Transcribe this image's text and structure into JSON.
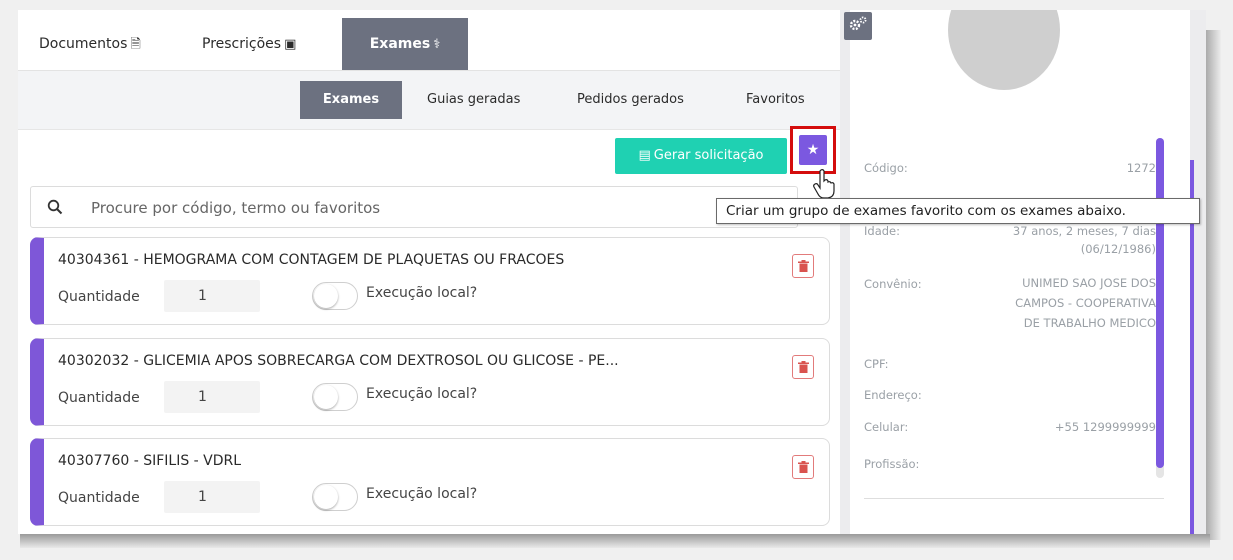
{
  "tabs": {
    "documents": "Documentos",
    "prescriptions": "Prescrições",
    "exams": "Exames"
  },
  "subtabs": {
    "exams": "Exames",
    "guides": "Guias geradas",
    "orders": "Pedidos gerados",
    "favorites": "Favoritos"
  },
  "actions": {
    "generate_request": "Gerar solicitação"
  },
  "search": {
    "placeholder": "Procure por código, termo ou favoritos"
  },
  "tooltip": "Criar um grupo de exames favorito com os exames abaixo.",
  "exam_items": [
    {
      "title": "40304361 - HEMOGRAMA COM CONTAGEM DE PLAQUETAS OU FRACOES",
      "qty_label": "Quantidade",
      "qty": "1",
      "exec_label": "Execução local?"
    },
    {
      "title": "40302032 - GLICEMIA APOS SOBRECARGA COM DEXTROSOL OU GLICOSE - PE...",
      "qty_label": "Quantidade",
      "qty": "1",
      "exec_label": "Execução local?"
    },
    {
      "title": "40307760 - SIFILIS - VDRL",
      "qty_label": "Quantidade",
      "qty": "1",
      "exec_label": "Execução local?"
    }
  ],
  "patient": {
    "code_label": "Código:",
    "code": "1272",
    "age_label": "Idade:",
    "age": "37 anos, 2 meses, 7 dias",
    "birth": "(06/12/1986)",
    "insurance_label": "Convênio:",
    "insurance": [
      "UNIMED SAO JOSE DOS",
      "CAMPOS - COOPERATIVA",
      "DE TRABALHO MEDICO"
    ],
    "cpf_label": "CPF:",
    "address_label": "Endereço:",
    "phone_label": "Celular:",
    "phone": "+55 1299999999",
    "profession_label": "Profissão:"
  },
  "colors": {
    "accent_purple": "#7b58e0",
    "teal": "#1fd1b2",
    "tab_active": "#6c7180",
    "highlight_red": "#d40d0d"
  }
}
